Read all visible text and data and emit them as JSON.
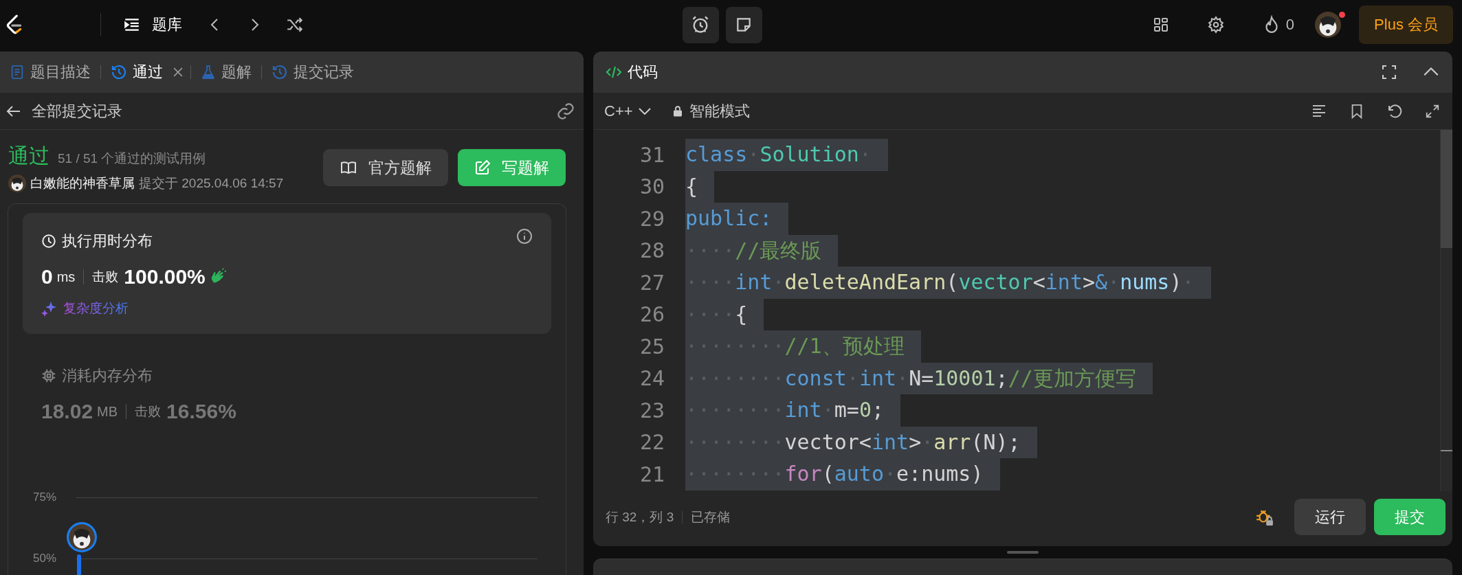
{
  "top_bar": {
    "problem_list_label": "题库",
    "streak_count": "0",
    "avatar_notification": true,
    "plus_button": "Plus 会员"
  },
  "left_panel": {
    "tabs": [
      {
        "label": "题目描述",
        "kind": "description",
        "selected": false,
        "closable": false
      },
      {
        "label": "通过",
        "kind": "result",
        "selected": true,
        "closable": true
      },
      {
        "label": "题解",
        "kind": "solutions",
        "selected": false,
        "closable": false
      },
      {
        "label": "提交记录",
        "kind": "submissions",
        "selected": false,
        "closable": false
      }
    ],
    "back_label": "全部提交记录",
    "result": {
      "status": "通过",
      "testcases": "51 / 51 个通过的测试用例",
      "user": "白嫩能的神香草属",
      "submitted": "提交于 2025.04.06 14:57"
    },
    "buttons": [
      {
        "label": "官方题解",
        "kind": "secondary"
      },
      {
        "label": "写题解",
        "kind": "primary"
      }
    ],
    "metrics": [
      {
        "kind": "runtime",
        "title": "执行用时分布",
        "value": "0",
        "unit": "ms",
        "beats_label": "击败",
        "beats": "100.00%",
        "celebrate": true,
        "analysis_link": "复杂度分析",
        "selected": true
      },
      {
        "kind": "memory",
        "title": "消耗内存分布",
        "value": "18.02",
        "unit": "MB",
        "beats_label": "击败",
        "beats": "16.56%",
        "celebrate": false,
        "selected": false
      }
    ],
    "chart": {
      "y_labels": [
        "75%",
        "50%"
      ]
    }
  },
  "code_panel": {
    "title": "代码",
    "language": "C++",
    "mode": "智能模式",
    "lines": [
      {
        "number": "31",
        "tokens": [
          {
            "text": "class",
            "kind": "keyword"
          },
          {
            "text": "·",
            "kind": "whitespace"
          },
          {
            "text": "Solution",
            "kind": "type"
          },
          {
            "text": "·",
            "kind": "whitespace"
          }
        ]
      },
      {
        "number": "30",
        "tokens": [
          {
            "text": "{",
            "kind": "plain"
          }
        ]
      },
      {
        "number": "29",
        "tokens": [
          {
            "text": "public:",
            "kind": "keyword"
          }
        ]
      },
      {
        "number": "28",
        "tokens": [
          {
            "text": "····",
            "kind": "whitespace"
          },
          {
            "text": "//最终版",
            "kind": "comment"
          }
        ]
      },
      {
        "number": "27",
        "tokens": [
          {
            "text": "····",
            "kind": "whitespace"
          },
          {
            "text": "int",
            "kind": "keyword"
          },
          {
            "text": "·",
            "kind": "whitespace"
          },
          {
            "text": "deleteAndEarn",
            "kind": "function"
          },
          {
            "text": "(",
            "kind": "plain"
          },
          {
            "text": "vector",
            "kind": "type"
          },
          {
            "text": "<",
            "kind": "plain"
          },
          {
            "text": "int",
            "kind": "keyword"
          },
          {
            "text": ">",
            "kind": "plain"
          },
          {
            "text": "&",
            "kind": "keyword"
          },
          {
            "text": "·",
            "kind": "whitespace"
          },
          {
            "text": "nums",
            "kind": "parameter"
          },
          {
            "text": ")",
            "kind": "plain"
          },
          {
            "text": "·",
            "kind": "whitespace"
          }
        ]
      },
      {
        "number": "26",
        "tokens": [
          {
            "text": "····",
            "kind": "whitespace"
          },
          {
            "text": "{",
            "kind": "plain"
          }
        ]
      },
      {
        "number": "25",
        "tokens": [
          {
            "text": "········",
            "kind": "whitespace"
          },
          {
            "text": "//1、预处理",
            "kind": "comment"
          }
        ]
      },
      {
        "number": "24",
        "tokens": [
          {
            "text": "········",
            "kind": "whitespace"
          },
          {
            "text": "const",
            "kind": "keyword"
          },
          {
            "text": "·",
            "kind": "whitespace"
          },
          {
            "text": "int",
            "kind": "keyword"
          },
          {
            "text": "·",
            "kind": "whitespace"
          },
          {
            "text": "N=",
            "kind": "plain"
          },
          {
            "text": "10001",
            "kind": "number"
          },
          {
            "text": ";",
            "kind": "plain"
          },
          {
            "text": "//更加方便写",
            "kind": "comment"
          }
        ]
      },
      {
        "number": "23",
        "tokens": [
          {
            "text": "········",
            "kind": "whitespace"
          },
          {
            "text": "int",
            "kind": "keyword"
          },
          {
            "text": "·",
            "kind": "whitespace"
          },
          {
            "text": "m=",
            "kind": "plain"
          },
          {
            "text": "0",
            "kind": "number"
          },
          {
            "text": ";",
            "kind": "plain"
          }
        ]
      },
      {
        "number": "22",
        "tokens": [
          {
            "text": "········",
            "kind": "whitespace"
          },
          {
            "text": "vector<",
            "kind": "plain"
          },
          {
            "text": "int",
            "kind": "keyword"
          },
          {
            "text": ">",
            "kind": "plain"
          },
          {
            "text": "·",
            "kind": "whitespace"
          },
          {
            "text": "arr",
            "kind": "function"
          },
          {
            "text": "(N);",
            "kind": "plain"
          }
        ]
      },
      {
        "number": "21",
        "tokens": [
          {
            "text": "········",
            "kind": "whitespace"
          },
          {
            "text": "for",
            "kind": "control"
          },
          {
            "text": "(",
            "kind": "plain"
          },
          {
            "text": "auto",
            "kind": "keyword"
          },
          {
            "text": "·",
            "kind": "whitespace"
          },
          {
            "text": "e:nums)",
            "kind": "plain"
          }
        ]
      }
    ],
    "cursor": "行 32，列 3",
    "save_status": "已存储",
    "buttons": [
      {
        "label": "运行",
        "kind": "secondary"
      },
      {
        "label": "提交",
        "kind": "primary"
      }
    ]
  }
}
